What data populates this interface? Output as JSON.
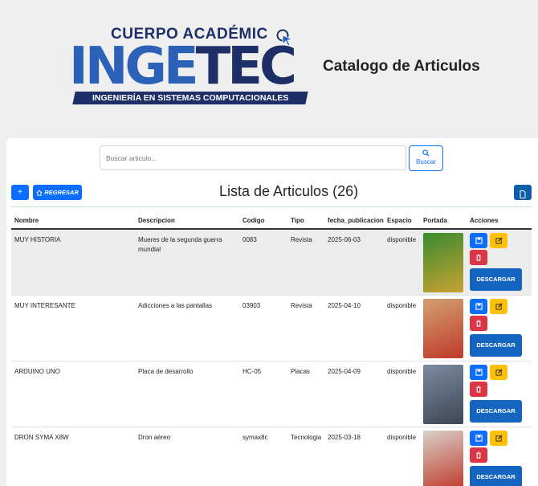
{
  "logo": {
    "top_text": "CUERPO ACADÉMIC",
    "main_text_a": "INGE",
    "main_text_b": "TEC",
    "bar_text": "INGENIERÍA EN SISTEMAS COMPUTACIONALES"
  },
  "header": {
    "title": "Catalogo de Articulos"
  },
  "search": {
    "placeholder": "Buscar articulo...",
    "button_label": "Buscar"
  },
  "toolbar": {
    "add_label": "+",
    "back_label": "REGRESAR",
    "list_title": "Lista de Articulos (26)"
  },
  "table": {
    "columns": [
      "Nombre",
      "Descripcion",
      "Codigo",
      "Tipo",
      "fecha_publicacion",
      "Espacio",
      "Portada",
      "Acciones"
    ],
    "rows": [
      {
        "nombre": "MUY HISTORIA",
        "descripcion": "Mueres de la segunda guerra mundial",
        "codigo": "0083",
        "tipo": "Revista",
        "fecha": "2025-06-03",
        "espacio": "disponible",
        "cover_colors": [
          "#3a8a2f",
          "#c8a232"
        ]
      },
      {
        "nombre": "MUY INTERESANTE",
        "descripcion": "Adicciones a las pantallas",
        "codigo": "03903",
        "tipo": "Revista",
        "fecha": "2025-04-10",
        "espacio": "disponible",
        "cover_colors": [
          "#d2a070",
          "#c0392b"
        ]
      },
      {
        "nombre": "ARDUINO UNO",
        "descripcion": "Placa de desarrollo",
        "codigo": "HC-05",
        "tipo": "Placas",
        "fecha": "2025-04-09",
        "espacio": "disponible",
        "cover_colors": [
          "#7d8aa0",
          "#3c4656"
        ]
      },
      {
        "nombre": "DRON SYMA X8W",
        "descripcion": "Dron aéreo",
        "codigo": "symax8c",
        "tipo": "Tecnologia",
        "fecha": "2025-03-18",
        "espacio": "disponible",
        "cover_colors": [
          "#d8d0c8",
          "#c0392b"
        ]
      }
    ],
    "download_label": "DESCARGAR"
  },
  "icons": [
    "search-icon",
    "house-icon",
    "file-pdf-icon",
    "save-icon",
    "edit-icon",
    "trash-icon",
    "cursor-icon"
  ],
  "colors": {
    "primary": "#0d6efd",
    "warning": "#ffc107",
    "danger": "#dc3545",
    "download": "#1565c0",
    "brand_dark": "#1d2f66",
    "brand_light": "#2b62b8"
  }
}
